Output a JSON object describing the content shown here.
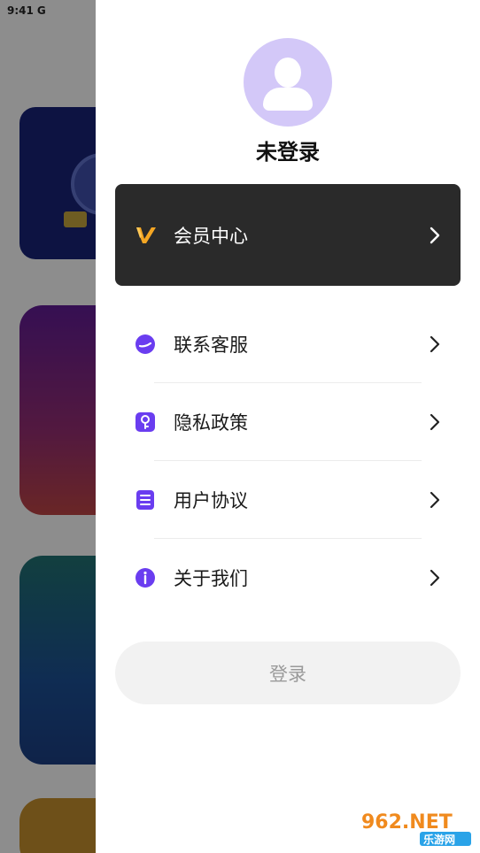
{
  "status_bar": {
    "time": "9:41",
    "carrier_glyph": "G"
  },
  "drawer": {
    "username": "未登录",
    "vip": {
      "label": "会员中心",
      "icon": "v-icon",
      "accent": "#f5a623"
    },
    "menu": [
      {
        "label": "联系客服",
        "icon": "service-icon"
      },
      {
        "label": "隐私政策",
        "icon": "privacy-icon"
      },
      {
        "label": "用户协议",
        "icon": "agreement-icon"
      },
      {
        "label": "关于我们",
        "icon": "info-icon"
      }
    ],
    "login_label": "登录",
    "accent_color": "#6a3df0"
  },
  "watermark": {
    "text_top": "962.NET",
    "text_bottom": "乐游网"
  }
}
